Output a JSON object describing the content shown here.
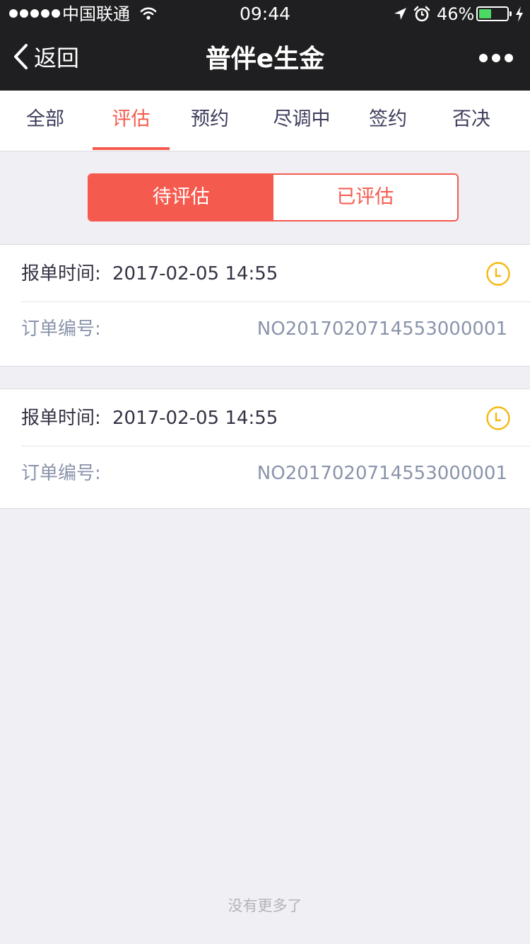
{
  "status_bar": {
    "carrier": "中国联通",
    "time": "09:44",
    "battery_percent": "46%",
    "battery_level": 0.46,
    "signal_bars": 5
  },
  "nav": {
    "back_label": "返回",
    "title": "普伴e生金"
  },
  "tabs": [
    {
      "label": "全部",
      "active": false
    },
    {
      "label": "评估",
      "active": true
    },
    {
      "label": "预约",
      "active": false
    },
    {
      "label": "尽调中",
      "active": false
    },
    {
      "label": "签约",
      "active": false
    },
    {
      "label": "否决",
      "active": false
    }
  ],
  "segment": {
    "pending_label": "待评估",
    "done_label": "已评估",
    "selected": "pending"
  },
  "orders": [
    {
      "time_label": "报单时间:",
      "time_value": "2017-02-05 14:55",
      "order_label": "订单编号:",
      "order_value": "NO2017020714553000001",
      "status_icon": "clock-icon"
    },
    {
      "time_label": "报单时间:",
      "time_value": "2017-02-05 14:55",
      "order_label": "订单编号:",
      "order_value": "NO2017020714553000001",
      "status_icon": "clock-icon"
    }
  ],
  "footer": {
    "no_more_text": "没有更多了"
  },
  "colors": {
    "accent": "#f55a4e",
    "bar_bg": "#1f1f21",
    "page_bg": "#efeff4",
    "clock_icon": "#f5b80f",
    "battery_fill": "#4cd964"
  }
}
